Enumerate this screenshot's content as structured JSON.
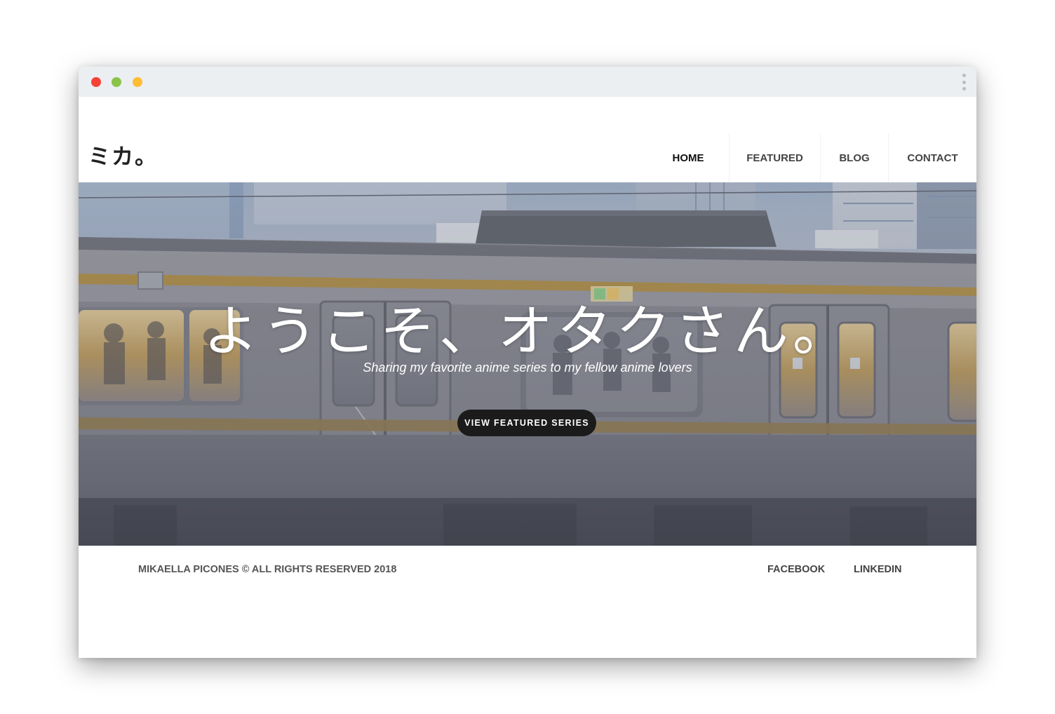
{
  "window": {
    "controls": [
      {
        "name": "close",
        "color": "#f44336"
      },
      {
        "name": "minimize",
        "color": "#8bc34a"
      },
      {
        "name": "maximize",
        "color": "#ffbc35"
      }
    ],
    "menu_icon": "kebab-menu-icon"
  },
  "header": {
    "logo": "ミカ。",
    "nav": [
      {
        "label": "HOME",
        "active": true
      },
      {
        "label": "FEATURED",
        "active": false
      },
      {
        "label": "BLOG",
        "active": false
      },
      {
        "label": "CONTACT",
        "active": false
      }
    ]
  },
  "hero": {
    "title": "ようこそ、オタクさん。",
    "subtitle": "Sharing my favorite anime series to my fellow anime lovers",
    "cta_label": "VIEW FEATURED SERIES",
    "background": "commuter-train-at-station-image",
    "colors": {
      "train_body": "#8a8a92",
      "accent_stripe": "#b39245",
      "overlay": "#5a5e6c"
    }
  },
  "footer": {
    "copyright": "MIKAELLA PICONES © ALL RIGHTS RESERVED 2018",
    "links": [
      {
        "label": "FACEBOOK"
      },
      {
        "label": "LINKEDIN"
      }
    ]
  }
}
